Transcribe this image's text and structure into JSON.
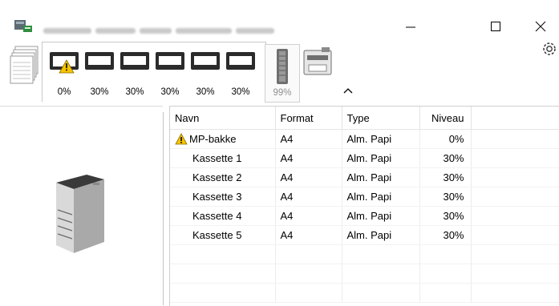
{
  "window": {
    "title_obscured": true,
    "controls": {
      "minimize": "minimize-icon",
      "maximize": "maximize-icon",
      "close": "close-icon"
    }
  },
  "toolbar": {
    "trays": [
      {
        "id": "mp-tray",
        "percent": "0%",
        "warning": true
      },
      {
        "id": "cassette-1",
        "percent": "30%",
        "warning": false
      },
      {
        "id": "cassette-2",
        "percent": "30%",
        "warning": false
      },
      {
        "id": "cassette-3",
        "percent": "30%",
        "warning": false
      },
      {
        "id": "cassette-4",
        "percent": "30%",
        "warning": false
      },
      {
        "id": "cassette-5",
        "percent": "30%",
        "warning": false
      }
    ],
    "toner": {
      "percent": "99%"
    },
    "icons": {
      "stack": "paper-stack-icon",
      "printer": "printer-tab-icon",
      "collapse": "collapse-chevron-icon",
      "settings": "gear-icon"
    }
  },
  "table": {
    "headers": {
      "name": "Navn",
      "format": "Format",
      "type": "Type",
      "level": "Niveau"
    },
    "rows": [
      {
        "name": "MP-bakke",
        "format": "A4",
        "type": "Alm. Papi",
        "level": "0%",
        "warning": true
      },
      {
        "name": "Kassette 1",
        "format": "A4",
        "type": "Alm. Papi",
        "level": "30%",
        "warning": false
      },
      {
        "name": "Kassette 2",
        "format": "A4",
        "type": "Alm. Papi",
        "level": "30%",
        "warning": false
      },
      {
        "name": "Kassette 3",
        "format": "A4",
        "type": "Alm. Papi",
        "level": "30%",
        "warning": false
      },
      {
        "name": "Kassette 4",
        "format": "A4",
        "type": "Alm. Papi",
        "level": "30%",
        "warning": false
      },
      {
        "name": "Kassette 5",
        "format": "A4",
        "type": "Alm. Papi",
        "level": "30%",
        "warning": false
      }
    ]
  },
  "colors": {
    "warning": "#f5c400",
    "border": "#c9c9c9",
    "toner_text": "#8f8f8f"
  }
}
